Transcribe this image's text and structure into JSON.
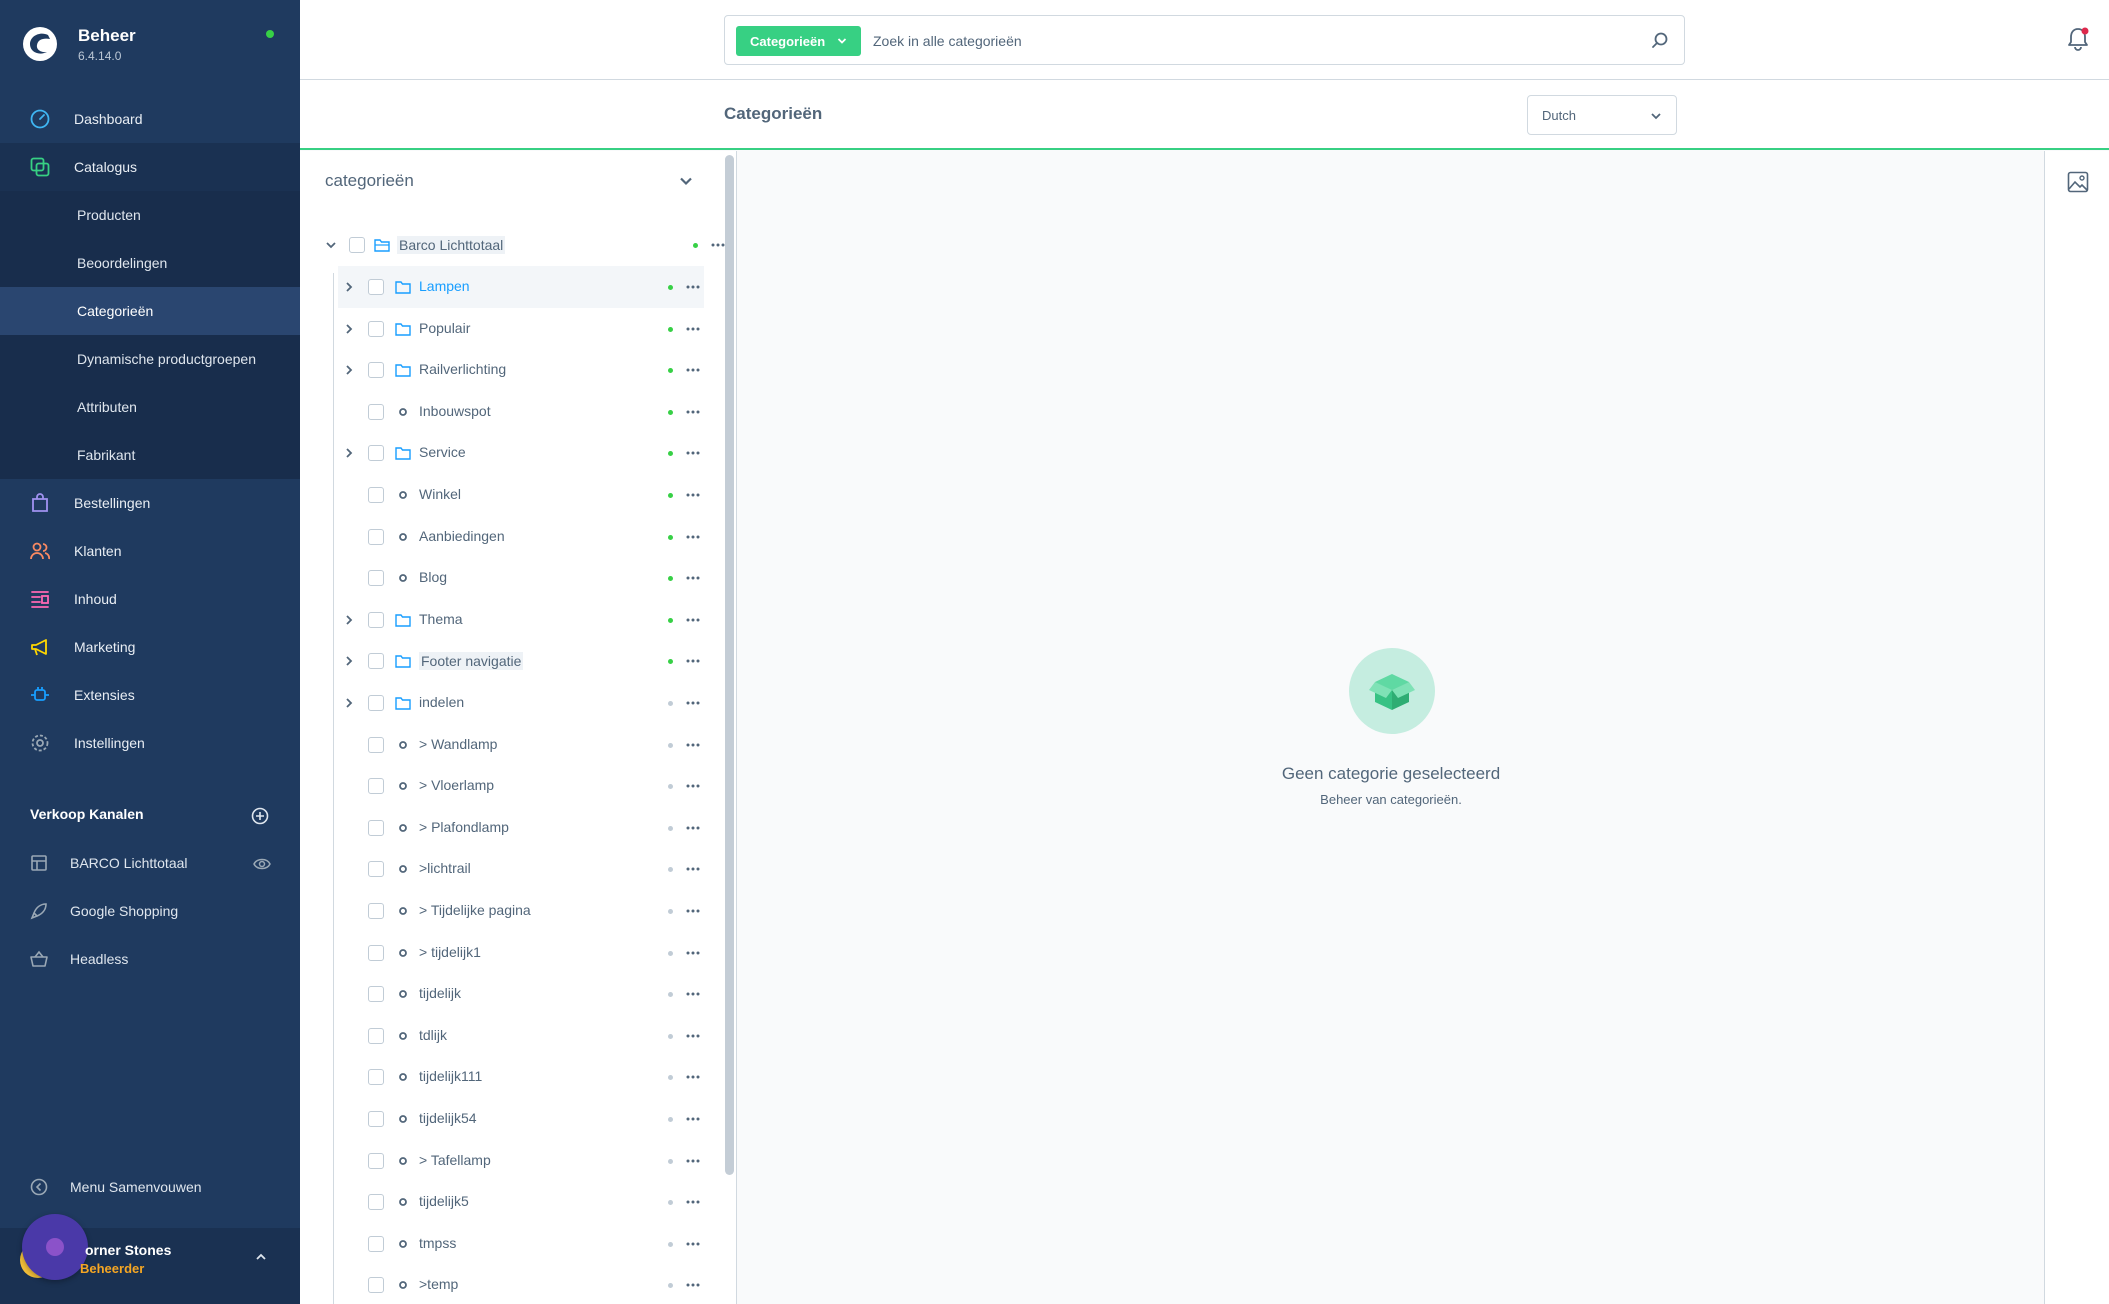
{
  "brand": {
    "title": "Beheer",
    "version": "6.4.14.0"
  },
  "nav": {
    "dashboard": "Dashboard",
    "catalogus": "Catalogus",
    "sub": [
      "Producten",
      "Beoordelingen",
      "Categorieën",
      "Dynamische productgroepen",
      "Attributen",
      "Fabrikant"
    ],
    "bestellingen": "Bestellingen",
    "klanten": "Klanten",
    "inhoud": "Inhoud",
    "marketing": "Marketing",
    "extensies": "Extensies",
    "instellingen": "Instellingen"
  },
  "sales_channels": {
    "title": "Verkoop Kanalen",
    "items": [
      "BARCO Lichttotaal",
      "Google Shopping",
      "Headless"
    ]
  },
  "collapse_label": "Menu Samenvouwen",
  "user": {
    "name": "orner Stones",
    "role": "Beheerder"
  },
  "search": {
    "type_label": "Categorieën",
    "placeholder": "Zoek in alle categorieën"
  },
  "page_title": "Categorieën",
  "language": "Dutch",
  "tree": {
    "header": "categorieën",
    "root": "Barco Lichttotaal",
    "items": [
      {
        "label": "Lampen",
        "type": "folder",
        "expandable": true,
        "active": true
      },
      {
        "label": "Populair",
        "type": "folder",
        "expandable": true,
        "active": true
      },
      {
        "label": "Railverlichting",
        "type": "folder",
        "expandable": true,
        "active": true
      },
      {
        "label": "Inbouwspot",
        "type": "leaf",
        "expandable": false,
        "active": true
      },
      {
        "label": "Service",
        "type": "folder",
        "expandable": true,
        "active": true
      },
      {
        "label": "Winkel",
        "type": "leaf",
        "expandable": false,
        "active": true
      },
      {
        "label": "Aanbiedingen",
        "type": "leaf",
        "expandable": false,
        "active": true
      },
      {
        "label": "Blog",
        "type": "leaf",
        "expandable": false,
        "active": true
      },
      {
        "label": "Thema",
        "type": "folder",
        "expandable": true,
        "active": true
      },
      {
        "label": "Footer navigatie",
        "type": "folder",
        "expandable": true,
        "active": true
      },
      {
        "label": "indelen",
        "type": "folder",
        "expandable": true,
        "active": false
      },
      {
        "label": "> Wandlamp",
        "type": "leaf",
        "expandable": false,
        "active": false
      },
      {
        "label": "> Vloerlamp",
        "type": "leaf",
        "expandable": false,
        "active": false
      },
      {
        "label": "> Plafondlamp",
        "type": "leaf",
        "expandable": false,
        "active": false
      },
      {
        "label": ">lichtrail",
        "type": "leaf",
        "expandable": false,
        "active": false
      },
      {
        "label": "> Tijdelijke pagina",
        "type": "leaf",
        "expandable": false,
        "active": false
      },
      {
        "label": "> tijdelijk1",
        "type": "leaf",
        "expandable": false,
        "active": false
      },
      {
        "label": "tijdelijk",
        "type": "leaf",
        "expandable": false,
        "active": false
      },
      {
        "label": "tdlijk",
        "type": "leaf",
        "expandable": false,
        "active": false
      },
      {
        "label": "tijdelijk111",
        "type": "leaf",
        "expandable": false,
        "active": false
      },
      {
        "label": "tijdelijk54",
        "type": "leaf",
        "expandable": false,
        "active": false
      },
      {
        "label": "> Tafellamp",
        "type": "leaf",
        "expandable": false,
        "active": false
      },
      {
        "label": "tijdelijk5",
        "type": "leaf",
        "expandable": false,
        "active": false
      },
      {
        "label": "tmpss",
        "type": "leaf",
        "expandable": false,
        "active": false
      },
      {
        "label": ">temp",
        "type": "leaf",
        "expandable": false,
        "active": false
      }
    ]
  },
  "empty_state": {
    "title": "Geen categorie geselecteerd",
    "subtitle": "Beheer van categorieën."
  },
  "colors": {
    "sidebar": "#1f3a5f",
    "accent": "#37d083",
    "active_dot": "#37d046",
    "inactive_dot": "#c1ccd6",
    "link": "#189eff"
  }
}
